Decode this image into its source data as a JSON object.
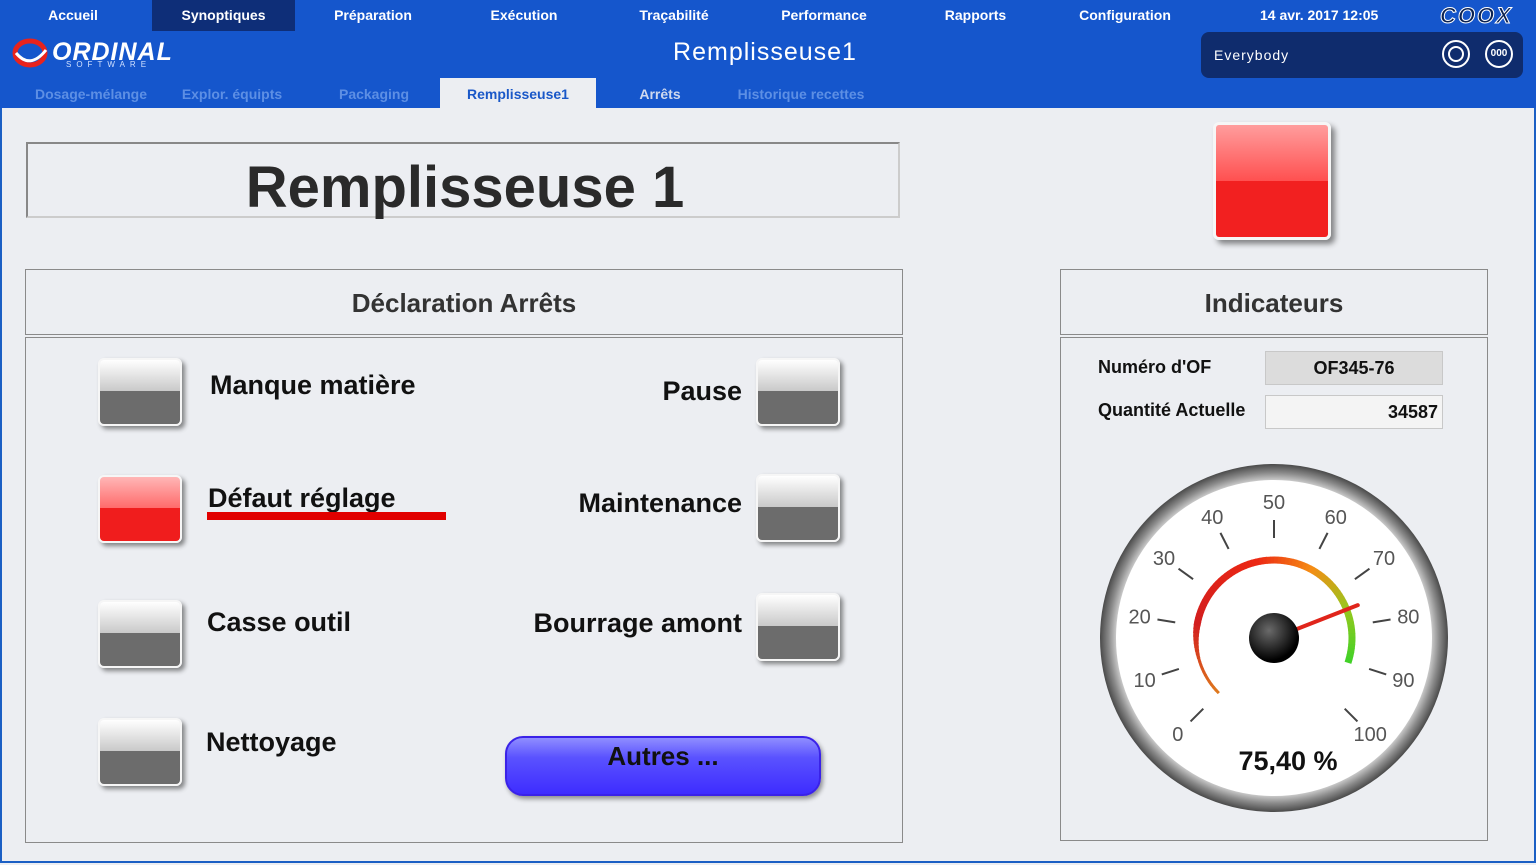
{
  "menu": {
    "items": [
      "Accueil",
      "Synoptiques",
      "Préparation",
      "Exécution",
      "Traçabilité",
      "Performance",
      "Rapports",
      "Configuration"
    ],
    "active": "Synoptiques"
  },
  "datetime": "14 avr. 2017 12:05",
  "brand": {
    "logo": "ORDINAL",
    "logo_sub": "SOFTWARE",
    "product": "COOX"
  },
  "screen_title": "Remplisseuse1",
  "user": {
    "name": "Everybody",
    "icon_right": "000"
  },
  "subtabs": [
    "Dosage-mélange",
    "Explor. équipts",
    "Packaging",
    "Remplisseuse1",
    "Arrêts",
    "Historique recettes"
  ],
  "active_subtab": "Remplisseuse1",
  "page_title": "Remplisseuse 1",
  "declaration": {
    "title": "Déclaration Arrêts",
    "stops": {
      "manque_matiere": "Manque matière",
      "defaut_reglage": "Défaut réglage",
      "casse_outil": "Casse outil",
      "nettoyage": "Nettoyage",
      "pause": "Pause",
      "maintenance": "Maintenance",
      "bourrage_amont": "Bourrage amont"
    },
    "active_stop": "Défaut réglage",
    "autres": "Autres ..."
  },
  "indicateurs": {
    "title": "Indicateurs",
    "of_label": "Numéro d'OF",
    "of_value": "OF345-76",
    "qty_label": "Quantité Actuelle",
    "qty_value": "34587",
    "gauge": {
      "ticks": [
        "0",
        "10",
        "20",
        "30",
        "40",
        "50",
        "60",
        "70",
        "80",
        "90",
        "100"
      ],
      "value": 75.4,
      "readout": "75,40 %"
    }
  },
  "colors": {
    "header": "#1556cc",
    "active_menu": "#0e2e78",
    "alert_red": "#f01d1d",
    "autres_button": "#4a3cff"
  }
}
